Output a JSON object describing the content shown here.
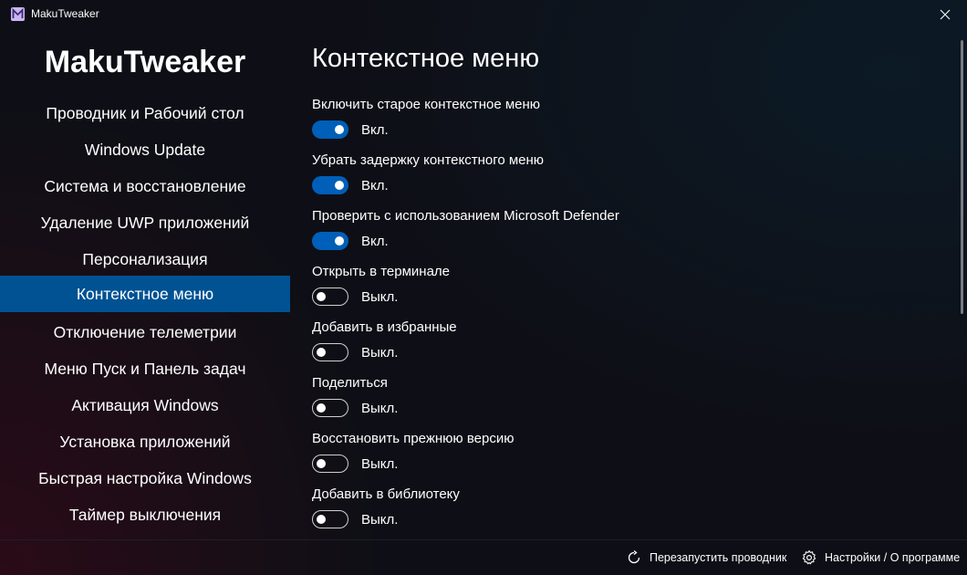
{
  "window": {
    "title": "MakuTweaker"
  },
  "sidebar": {
    "title": "MakuTweaker",
    "items": [
      {
        "label": "Проводник и Рабочий стол"
      },
      {
        "label": "Windows Update"
      },
      {
        "label": "Система и восстановление"
      },
      {
        "label": "Удаление UWP приложений"
      },
      {
        "label": "Персонализация"
      },
      {
        "label": "Контекстное меню",
        "active": true
      },
      {
        "label": "Отключение телеметрии"
      },
      {
        "label": "Меню Пуск и Панель задач"
      },
      {
        "label": "Активация Windows"
      },
      {
        "label": "Установка приложений"
      },
      {
        "label": "Быстрая настройка Windows"
      },
      {
        "label": "Таймер выключения"
      }
    ]
  },
  "main": {
    "title": "Контекстное меню",
    "options": [
      {
        "label": "Включить старое контекстное меню",
        "state": "Вкл.",
        "on": true
      },
      {
        "label": "Убрать задержку контекстного меню",
        "state": "Вкл.",
        "on": true
      },
      {
        "label": "Проверить с использованием Microsoft Defender",
        "state": "Вкл.",
        "on": true
      },
      {
        "label": "Открыть в терминале",
        "state": "Выкл.",
        "on": false
      },
      {
        "label": "Добавить в избранные",
        "state": "Выкл.",
        "on": false
      },
      {
        "label": "Поделиться",
        "state": "Выкл.",
        "on": false
      },
      {
        "label": "Восстановить прежнюю версию",
        "state": "Выкл.",
        "on": false
      },
      {
        "label": "Добавить в библиотеку",
        "state": "Выкл.",
        "on": false
      }
    ]
  },
  "footer": {
    "restart_label": "Перезапустить проводник",
    "settings_label": "Настройки / О программе"
  },
  "colors": {
    "accent": "#005fb8",
    "active_nav": "#005293"
  }
}
